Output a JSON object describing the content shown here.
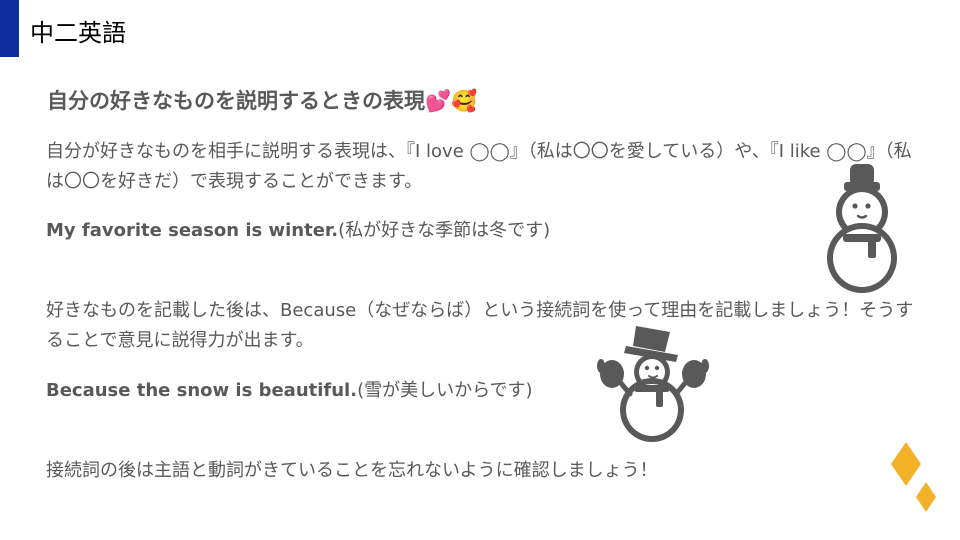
{
  "slide": {
    "title": "中二英語",
    "heading": "自分の好きなものを説明するときの表現",
    "heading_emoji": "💕🥰",
    "intro_text": "自分が好きなものを相手に説明する表現は、『I love ◯◯』（私は〇〇を愛している）や、『I like ◯◯』（私は〇〇を好きだ）で表現することができます。",
    "example1_en": "My favorite season is winter.",
    "example1_ja": "(私が好きな季節は冬です)",
    "because_text": "好きなものを記載した後は、Because（なぜならば）という接続詞を使って理由を記載しましょう！そうすることで意見に説得力が出ます。",
    "example2_en": "Because the snow is beautiful.",
    "example2_ja": "(雪が美しいからです)",
    "closing_text": "接続詞の後は主語と動詞がきていることを忘れないように確認しましょう！"
  },
  "colors": {
    "accent_bar": "#0f2e9e",
    "body_text": "#595959",
    "icon_gray": "#595959",
    "diamond_orange": "#f4b12a"
  },
  "icons": [
    "snowman-icon",
    "snowman-with-hat-icon",
    "diamond-decoration"
  ]
}
